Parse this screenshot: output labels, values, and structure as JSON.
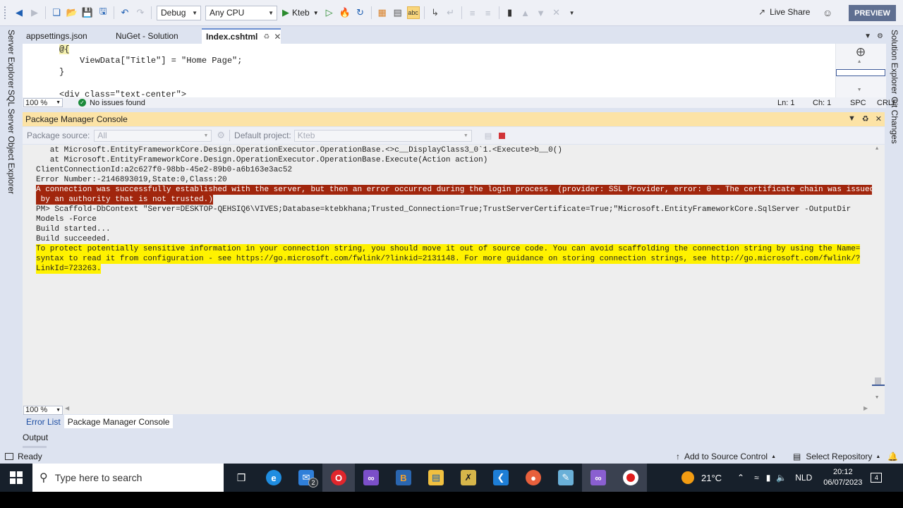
{
  "toolbar": {
    "config": "Debug",
    "platform": "Any CPU",
    "run_target": "Kteb",
    "live_share": "Live Share",
    "preview": "PREVIEW"
  },
  "side_panels": {
    "left": [
      "Server Explorer",
      "SQL Server Object Explorer"
    ],
    "right": [
      "Solution Explorer",
      "Git Changes"
    ]
  },
  "doc_tabs": [
    {
      "label": "appsettings.json"
    },
    {
      "label": "NuGet - Solution"
    },
    {
      "label": "Index.cshtml",
      "active": true
    }
  ],
  "editor": {
    "lines": [
      "@{",
      "ViewData[\"Title\"] = \"Home Page\";",
      "}",
      "<div class=\"text-center\">"
    ],
    "zoom": "100 %",
    "issues": "No issues found",
    "ln": "Ln: 1",
    "ch": "Ch: 1",
    "spc": "SPC",
    "eol": "CRLF"
  },
  "pmc": {
    "title": "Package Manager Console",
    "package_source_label": "Package source:",
    "package_source_value": "All",
    "default_project_label": "Default project:",
    "default_project_value": "Kteb",
    "lines": [
      {
        "text": "   at Microsoft.EntityFrameworkCore.Design.OperationExecutor.OperationBase.<>c__DisplayClass3_0`1.<Execute>b__0()",
        "type": "normal"
      },
      {
        "text": "   at Microsoft.EntityFrameworkCore.Design.OperationExecutor.OperationBase.Execute(Action action)",
        "type": "normal"
      },
      {
        "text": "ClientConnectionId:a2c627f0-98bb-45e2-89b0-a6b163e3ac52",
        "type": "normal"
      },
      {
        "text": "Error Number:-2146893019,State:0,Class:20",
        "type": "normal"
      },
      {
        "text": "A connection was successfully established with the server, but then an error occurred during the login process. (provider: SSL Provider, error: 0 - The certificate chain was issued",
        "type": "err"
      },
      {
        "text": " by an authority that is not trusted.)",
        "type": "err"
      },
      {
        "text": "PM> Scaffold-DbContext \"Server=DESKTOP-QEHSIQ6\\VIVES;Database=ktebkhana;Trusted_Connection=True;TrustServerCertificate=True;\"Microsoft.EntityFrameworkCore.SqlServer -OutputDir",
        "type": "normal"
      },
      {
        "text": "Models -Force",
        "type": "normal"
      },
      {
        "text": "Build started...",
        "type": "normal"
      },
      {
        "text": "Build succeeded.",
        "type": "normal"
      },
      {
        "text": "To protect potentially sensitive information in your connection string, you should move it out of source code. You can avoid scaffolding the connection string by using the Name=",
        "type": "warn"
      },
      {
        "text": "syntax to read it from configuration - see https://go.microsoft.com/fwlink/?linkid=2131148. For more guidance on storing connection strings, see http://go.microsoft.com/fwlink/?",
        "type": "warn"
      },
      {
        "text": "LinkId=723263.",
        "type": "warn"
      }
    ],
    "zoom": "100 %"
  },
  "tool_tabs": [
    {
      "label": "Error List"
    },
    {
      "label": "Package Manager Console",
      "active": true
    }
  ],
  "output_tab": "Output",
  "statusbar": {
    "ready": "Ready",
    "source_control": "Add to Source Control",
    "repository": "Select Repository"
  },
  "taskbar": {
    "search_placeholder": "Type here to search",
    "mail_badge": "2",
    "temperature": "21°C",
    "language": "NLD",
    "time": "20:12",
    "date": "06/07/2023"
  },
  "colors": {
    "error_bg": "#a1260d",
    "warning_bg": "#fff200",
    "console_bg": "#eeeeee",
    "accent": "#6c8fd1"
  }
}
